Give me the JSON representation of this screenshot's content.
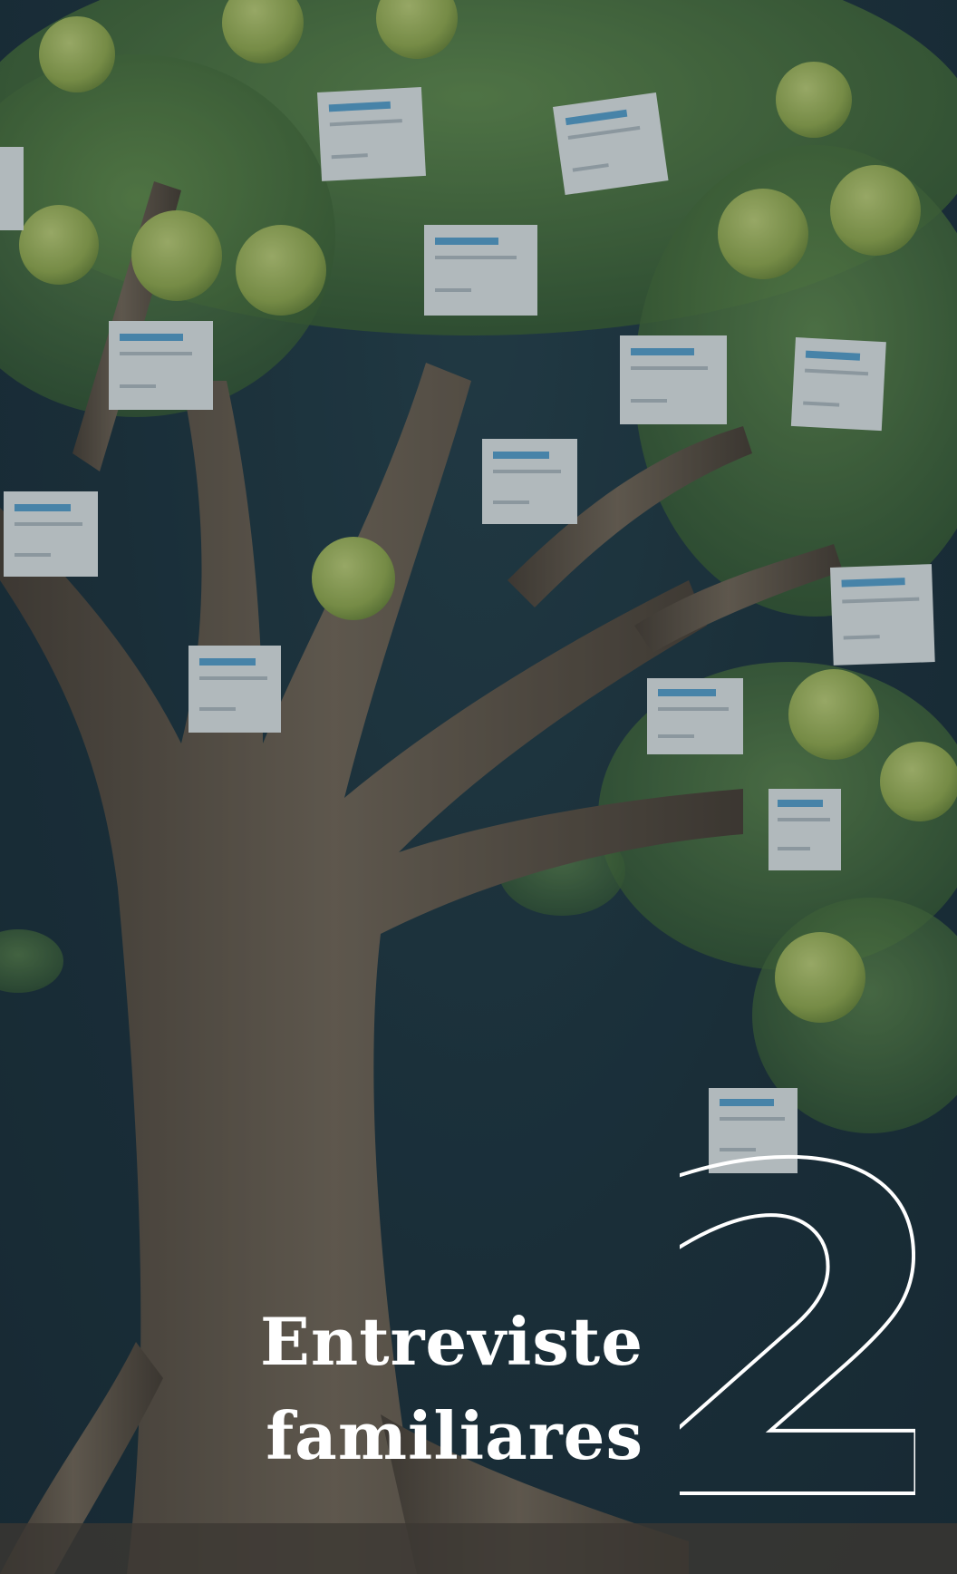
{
  "caption": {
    "line1": "Entreviste",
    "line2": "familiares"
  },
  "step_number": "2",
  "colors": {
    "background": "#1d3440",
    "caption_text": "#ffffff",
    "number_outline": "#ffffff",
    "leaves": "#4f7a3a",
    "apples": "#a8bf5a",
    "bark": "#6b5a47",
    "cards": "#eef1f2",
    "card_header": "#5aa7d6"
  }
}
